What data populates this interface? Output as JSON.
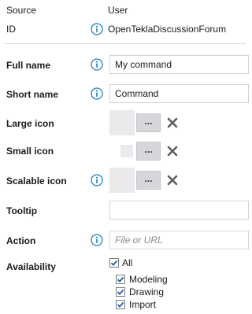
{
  "header": {
    "source_label": "Source",
    "source_value": "User",
    "id_label": "ID",
    "id_value": "OpenTeklaDiscussionForum"
  },
  "form": {
    "full_name_label": "Full name",
    "full_name_value": "My command",
    "short_name_label": "Short name",
    "short_name_value": "Command",
    "large_icon_label": "Large icon",
    "small_icon_label": "Small icon",
    "scalable_icon_label": "Scalable icon",
    "browse_label": "...",
    "tooltip_label": "Tooltip",
    "tooltip_value": "",
    "action_label": "Action",
    "action_placeholder": "File or URL",
    "availability_label": "Availability",
    "availability": {
      "all": {
        "label": "All",
        "checked": true
      },
      "options": [
        {
          "label": "Modeling",
          "checked": true
        },
        {
          "label": "Drawing",
          "checked": true
        },
        {
          "label": "Import",
          "checked": true
        }
      ]
    }
  },
  "icons": {
    "info": "info-circle-icon",
    "clear": "x-icon",
    "check": "checkmark-icon"
  },
  "colors": {
    "info_blue": "#1c7fc9",
    "clear_gray": "#5f5f5f",
    "check_blue": "#1c5fa8"
  }
}
